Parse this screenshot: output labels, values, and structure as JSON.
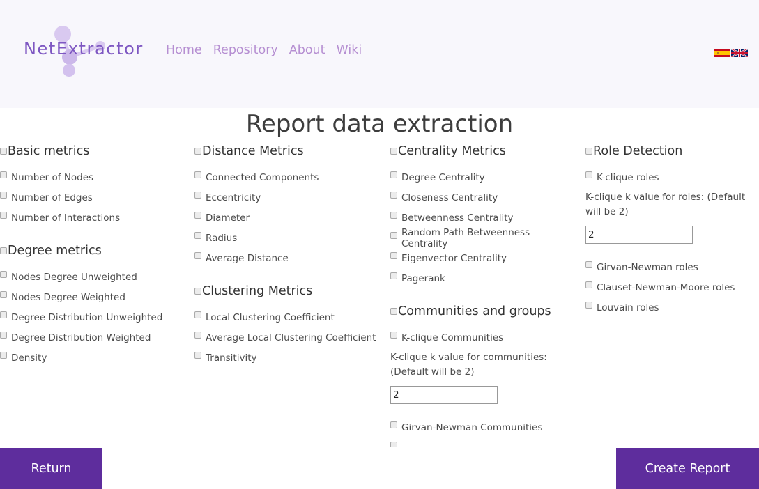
{
  "header": {
    "logo_text": "NetExtractor",
    "nav": [
      "Home",
      "Repository",
      "About",
      "Wiki"
    ],
    "flags": [
      "spanish-flag-icon",
      "english-flag-icon"
    ]
  },
  "title": "Report data extraction",
  "columns": [
    {
      "sections": [
        {
          "title": "Basic metrics",
          "items": [
            "Number of Nodes",
            "Number of Edges",
            "Number of Interactions"
          ]
        },
        {
          "title": "Degree metrics",
          "items": [
            "Nodes Degree Unweighted",
            "Nodes Degree Weighted",
            "Degree Distribution Unweighted",
            "Degree Distribution Weighted",
            "Density"
          ]
        }
      ]
    },
    {
      "sections": [
        {
          "title": "Distance Metrics",
          "items": [
            "Connected Components",
            "Eccentricity",
            "Diameter",
            "Radius",
            "Average Distance"
          ]
        },
        {
          "title": "Clustering Metrics",
          "items": [
            "Local Clustering Coefficient",
            "Average Local Clustering Coefficient",
            "Transitivity"
          ]
        }
      ]
    },
    {
      "sections": [
        {
          "title": "Centrality Metrics",
          "items": [
            "Degree Centrality",
            "Closeness Centrality",
            "Betweenness Centrality",
            "Random Path Betweenness Centrality",
            "Eigenvector Centrality",
            "Pagerank"
          ]
        },
        {
          "title": "Communities and groups",
          "items": [
            "K-clique Communities"
          ],
          "note": "K-clique k value for communities: (Default will be 2)",
          "input_value": "2",
          "items_after": [
            "Girvan-Newman Communities"
          ]
        }
      ]
    },
    {
      "sections": [
        {
          "title": "Role Detection",
          "items": [
            "K-clique roles"
          ],
          "note": "K-clique k value for roles: (Default will be 2)",
          "input_value": "2",
          "items_after": [
            "Girvan-Newman roles",
            "Clauset-Newman-Moore roles",
            "Louvain roles"
          ]
        }
      ]
    }
  ],
  "buttons": {
    "return": "Return",
    "create": "Create Report"
  },
  "colors": {
    "accent": "#5e2d9d",
    "nav": "#b68fd2",
    "header_bg": "#f8f7fc"
  }
}
